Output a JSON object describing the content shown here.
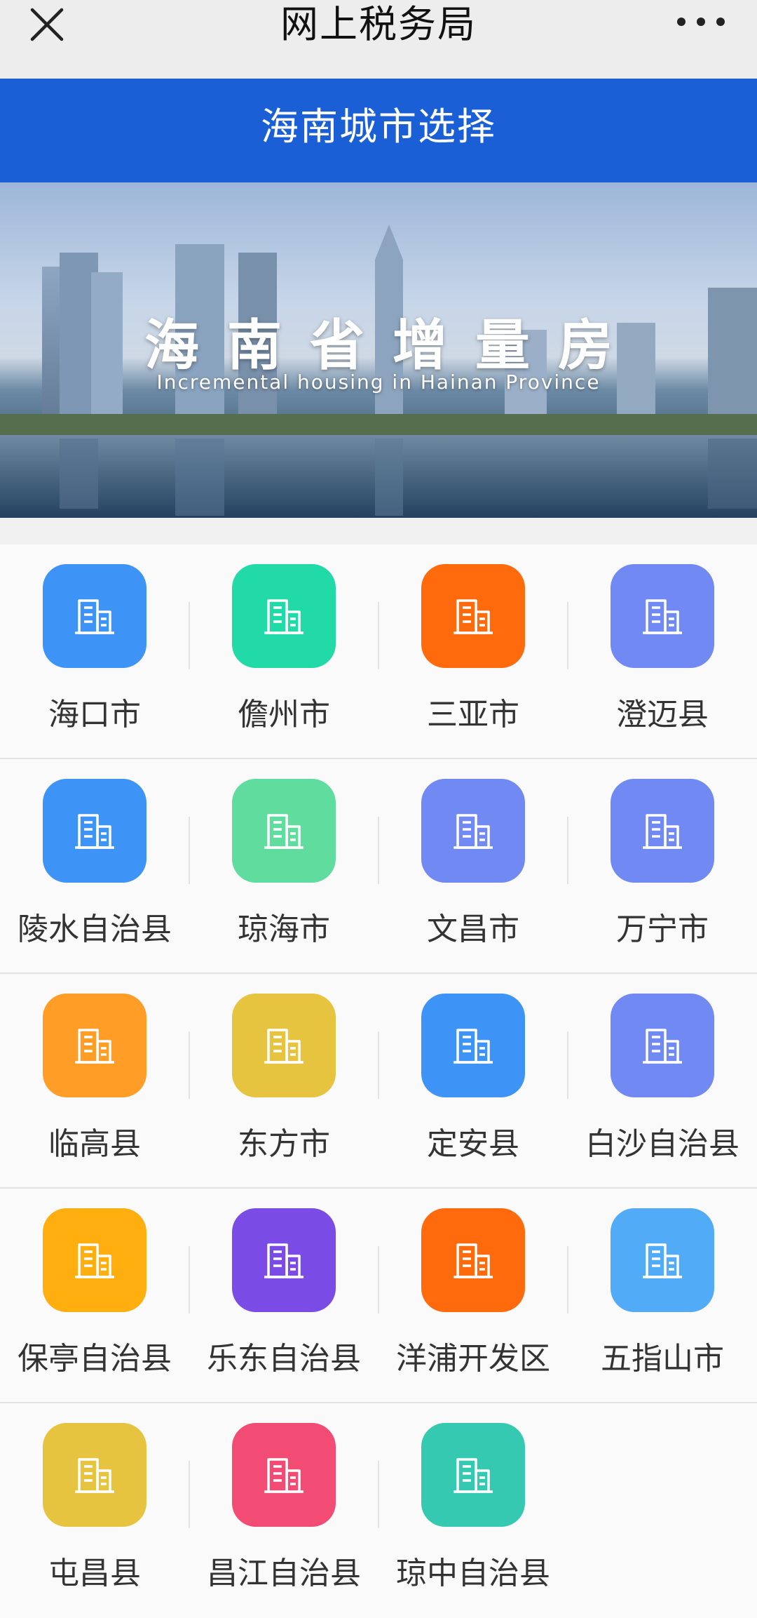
{
  "topbar": {
    "title": "网上税务局",
    "close_icon": "close-icon",
    "more_icon": "more-icon"
  },
  "header": {
    "title": "海南城市选择"
  },
  "banner": {
    "title": "海南省增量房",
    "subtitle": "Incremental housing in Hainan Province"
  },
  "cities": [
    {
      "label": "海口市",
      "color": "#3d94f6",
      "icon": "building-icon"
    },
    {
      "label": "儋州市",
      "color": "#22d9a8",
      "icon": "building-icon"
    },
    {
      "label": "三亚市",
      "color": "#ff6a0d",
      "icon": "building-icon"
    },
    {
      "label": "澄迈县",
      "color": "#7189f2",
      "icon": "building-icon"
    },
    {
      "label": "陵水自治县",
      "color": "#3d94f6",
      "icon": "building-icon"
    },
    {
      "label": "琼海市",
      "color": "#5fdc9e",
      "icon": "building-icon"
    },
    {
      "label": "文昌市",
      "color": "#7189f2",
      "icon": "building-icon"
    },
    {
      "label": "万宁市",
      "color": "#7189f2",
      "icon": "building-icon"
    },
    {
      "label": "临高县",
      "color": "#ff9d26",
      "icon": "building-icon"
    },
    {
      "label": "东方市",
      "color": "#e6c43f",
      "icon": "building-icon"
    },
    {
      "label": "定安县",
      "color": "#3d94f6",
      "icon": "building-icon"
    },
    {
      "label": "白沙自治县",
      "color": "#7189f2",
      "icon": "building-icon"
    },
    {
      "label": "保亭自治县",
      "color": "#ffae0f",
      "icon": "building-icon"
    },
    {
      "label": "乐东自治县",
      "color": "#7b4be6",
      "icon": "building-icon"
    },
    {
      "label": "洋浦开发区",
      "color": "#ff6a0d",
      "icon": "building-icon"
    },
    {
      "label": "五指山市",
      "color": "#52abf7",
      "icon": "building-icon"
    },
    {
      "label": "屯昌县",
      "color": "#e6c43f",
      "icon": "building-icon"
    },
    {
      "label": "昌江自治县",
      "color": "#f24b74",
      "icon": "building-icon"
    },
    {
      "label": "琼中自治县",
      "color": "#34c9b0",
      "icon": "building-icon"
    }
  ]
}
